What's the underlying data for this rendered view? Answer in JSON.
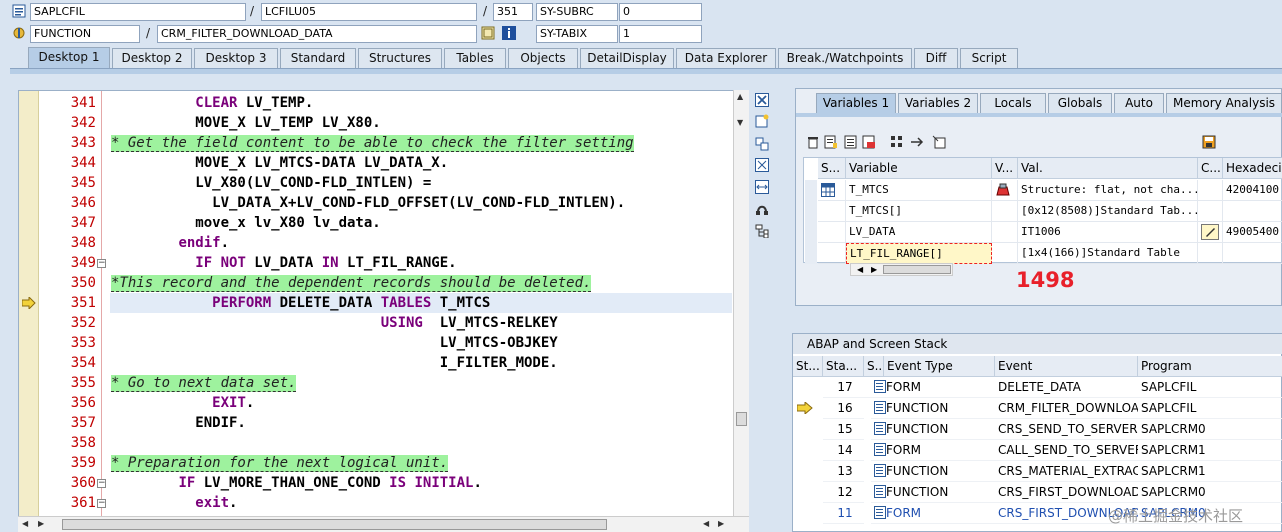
{
  "top": {
    "program": "SAPLCFIL",
    "include": "LCFILU05",
    "line": "351",
    "sysubrc_label": "SY-SUBRC",
    "sysubrc_value": "0",
    "event_type": "FUNCTION",
    "event": "CRM_FILTER_DOWNLOAD_DATA",
    "sytabix_label": "SY-TABIX",
    "sytabix_value": "1",
    "slash": "/"
  },
  "tabs": [
    "Desktop 1",
    "Desktop 2",
    "Desktop 3",
    "Standard",
    "Structures",
    "Tables",
    "Objects",
    "DetailDisplay",
    "Data Explorer",
    "Break./Watchpoints",
    "Diff",
    "Script"
  ],
  "editor": {
    "lines": [
      {
        "num": "341",
        "text": "          CLEAR LV_TEMP.",
        "type": "code"
      },
      {
        "num": "342",
        "text": "          MOVE_X LV_TEMP LV_X80.",
        "type": "code"
      },
      {
        "num": "343",
        "text": "* Get the field content to be able to check the filter setting",
        "type": "comment"
      },
      {
        "num": "344",
        "text": "          MOVE_X LV_MTCS-DATA LV_DATA_X.",
        "type": "code"
      },
      {
        "num": "345",
        "text": "          LV_X80(LV_COND-FLD_INTLEN) =",
        "type": "code"
      },
      {
        "num": "346",
        "text": "            LV_DATA_X+LV_COND-FLD_OFFSET(LV_COND-FLD_INTLEN).",
        "type": "code"
      },
      {
        "num": "347",
        "text": "          move_x lv_X80 lv_data.",
        "type": "code"
      },
      {
        "num": "348",
        "text": "        endif.",
        "type": "code"
      },
      {
        "num": "349",
        "text": "          IF NOT LV_DATA IN LT_FIL_RANGE.",
        "type": "code"
      },
      {
        "num": "350",
        "text": "*This record and the dependent records should be deleted.",
        "type": "comment"
      },
      {
        "num": "351",
        "text": "            PERFORM DELETE_DATA TABLES T_MTCS",
        "type": "code"
      },
      {
        "num": "352",
        "text": "                                USING  LV_MTCS-RELKEY",
        "type": "code"
      },
      {
        "num": "353",
        "text": "                                       LV_MTCS-OBJKEY",
        "type": "code"
      },
      {
        "num": "354",
        "text": "                                       I_FILTER_MODE.",
        "type": "code"
      },
      {
        "num": "355",
        "text": "* Go to next data set.",
        "type": "comment"
      },
      {
        "num": "356",
        "text": "            EXIT.",
        "type": "code"
      },
      {
        "num": "357",
        "text": "          ENDIF.",
        "type": "code"
      },
      {
        "num": "358",
        "text": "",
        "type": "code"
      },
      {
        "num": "359",
        "text": "* Preparation for the next logical unit.",
        "type": "comment"
      },
      {
        "num": "360",
        "text": "        IF LV_MORE_THAN_ONE_COND IS INITIAL.",
        "type": "code"
      },
      {
        "num": "361",
        "text": "          exit.",
        "type": "code"
      }
    ]
  },
  "vars_panel": {
    "tabs": [
      "Variables 1",
      "Variables 2",
      "Locals",
      "Globals",
      "Auto",
      "Memory Analysis"
    ],
    "headers": [
      "S...",
      "Variable",
      "V...",
      "Val.",
      "C...",
      "Hexadecim"
    ],
    "rows": [
      {
        "variable": "T_MTCS",
        "value": "Structure: flat, not cha...",
        "hex": "42004100"
      },
      {
        "variable": "T_MTCS[]",
        "value": "[0x12(8508)]Standard Tab...",
        "hex": ""
      },
      {
        "variable": "LV_DATA",
        "value": "IT1006",
        "hex": "49005400"
      },
      {
        "variable": "LT_FIL_RANGE[]",
        "value": "[1x4(166)]Standard Table",
        "hex": ""
      }
    ]
  },
  "annotation": "1498",
  "stack": {
    "title": "ABAP and Screen Stack",
    "headers": [
      "St...",
      "Sta...",
      "S...",
      "Event Type",
      "Event",
      "Program"
    ],
    "rows": [
      {
        "level": "17",
        "type": "FORM",
        "event": "DELETE_DATA",
        "program": "SAPLCFIL",
        "current": false
      },
      {
        "level": "16",
        "type": "FUNCTION",
        "event": "CRM_FILTER_DOWNLOA...",
        "program": "SAPLCFIL",
        "current": true
      },
      {
        "level": "15",
        "type": "FUNCTION",
        "event": "CRS_SEND_TO_SERVER",
        "program": "SAPLCRM0",
        "current": false
      },
      {
        "level": "14",
        "type": "FORM",
        "event": "CALL_SEND_TO_SERVER",
        "program": "SAPLCRM1",
        "current": false
      },
      {
        "level": "13",
        "type": "FUNCTION",
        "event": "CRS_MATERIAL_EXTRACT",
        "program": "SAPLCRM1",
        "current": false
      },
      {
        "level": "12",
        "type": "FUNCTION",
        "event": "CRS_FIRST_DOWNLOAD...",
        "program": "SAPLCRM0",
        "current": false
      },
      {
        "level": "11",
        "type": "FORM",
        "event": "CRS_FIRST_DOWNLOAD...",
        "program": "SAPLCRM0",
        "current": false
      }
    ]
  },
  "watermark": "@稀土掘金技术社区",
  "colors": {
    "accent": "#b6cde6",
    "comment_bg": "#9ef29e",
    "keyword": "#7a007a",
    "line_number": "#c00000",
    "annotation": "#e8202a"
  }
}
